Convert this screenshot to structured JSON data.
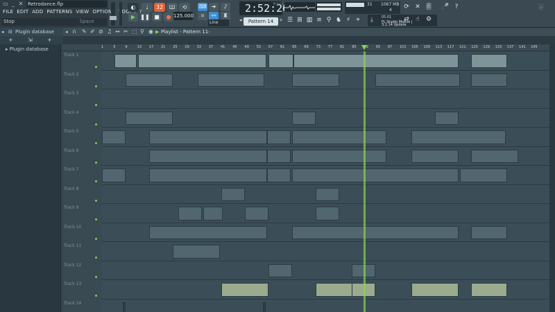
{
  "window": {
    "file_title": "Retrodance.flp"
  },
  "menu": [
    "FILE",
    "EDIT",
    "ADD",
    "PATTERNS",
    "VIEW",
    "OPTIONS",
    "TOOLS",
    "?"
  ],
  "hint": {
    "text": "Stop",
    "key": "Space"
  },
  "transport": {
    "tempo": "125.000"
  },
  "clock": {
    "time": "2:52:26",
    "unit": "M:S:CS"
  },
  "pattern": {
    "selected": "Pattern 14"
  },
  "snap": {
    "value": "Line"
  },
  "cpu": {
    "cpu": "31",
    "memory": "1067 MB",
    "polyphony": "4"
  },
  "news": {
    "date": "05.01",
    "title_line1": "FL Studio Mobile |",
    "title_line2": "3.2.14 Update"
  },
  "browser": {
    "title": "Plugin database",
    "item": "Plugin database"
  },
  "playlist": {
    "title": "Playlist - Pattern 11",
    "ruler": [
      "1",
      "5",
      "9",
      "13",
      "17",
      "21",
      "25",
      "29",
      "33",
      "37",
      "41",
      "45",
      "49",
      "53",
      "57",
      "61",
      "65",
      "69",
      "73",
      "77",
      "81",
      "85",
      "89",
      "93",
      "97",
      "101",
      "105",
      "109",
      "113",
      "117",
      "121",
      "125",
      "129",
      "133",
      "137",
      "141",
      "145"
    ],
    "tracks": [
      "Track 1",
      "Track 2",
      "Track 3",
      "Track 4",
      "Track 5",
      "Track 6",
      "Track 7",
      "Track 8",
      "Track 9",
      "Track 10",
      "Track 11",
      "Track 12",
      "Track 13",
      "Track 14"
    ]
  },
  "colors": {
    "accent": "#8bd44f",
    "count_button": "#e0623a",
    "record": "#ff6a4c"
  }
}
